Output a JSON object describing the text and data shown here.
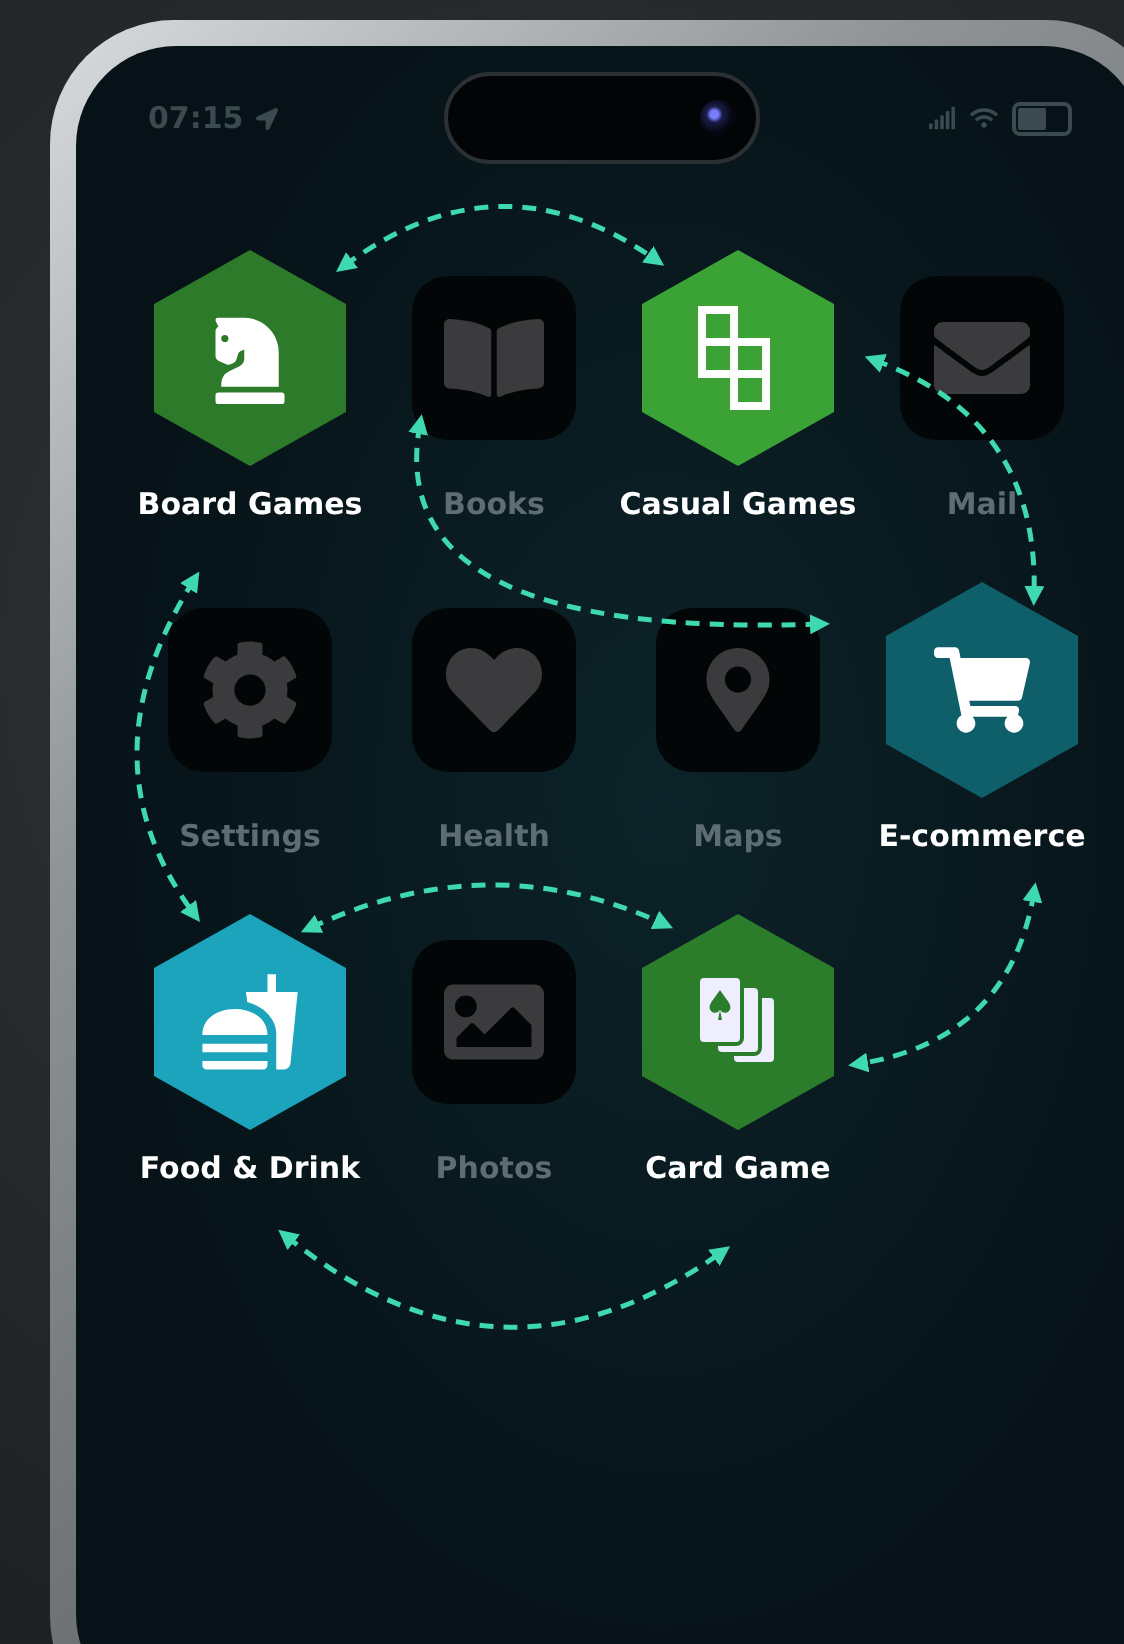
{
  "status_bar": {
    "time": "07:15"
  },
  "apps": [
    {
      "label": "Board Games",
      "kind": "featured",
      "color": "#2d7a2a"
    },
    {
      "label": "Books",
      "kind": "dimmed"
    },
    {
      "label": "Casual Games",
      "kind": "featured",
      "color": "#3ba336"
    },
    {
      "label": "Mail",
      "kind": "dimmed"
    },
    {
      "label": "Settings",
      "kind": "dimmed"
    },
    {
      "label": "Health",
      "kind": "dimmed"
    },
    {
      "label": "Maps",
      "kind": "dimmed"
    },
    {
      "label": "E-commerce",
      "kind": "featured",
      "color": "#0f5f6a"
    },
    {
      "label": "Food & Drink",
      "kind": "featured",
      "color": "#1ba4bb"
    },
    {
      "label": "Photos",
      "kind": "dimmed"
    },
    {
      "label": "Card Game",
      "kind": "featured",
      "color": "#2b7d2b"
    }
  ]
}
